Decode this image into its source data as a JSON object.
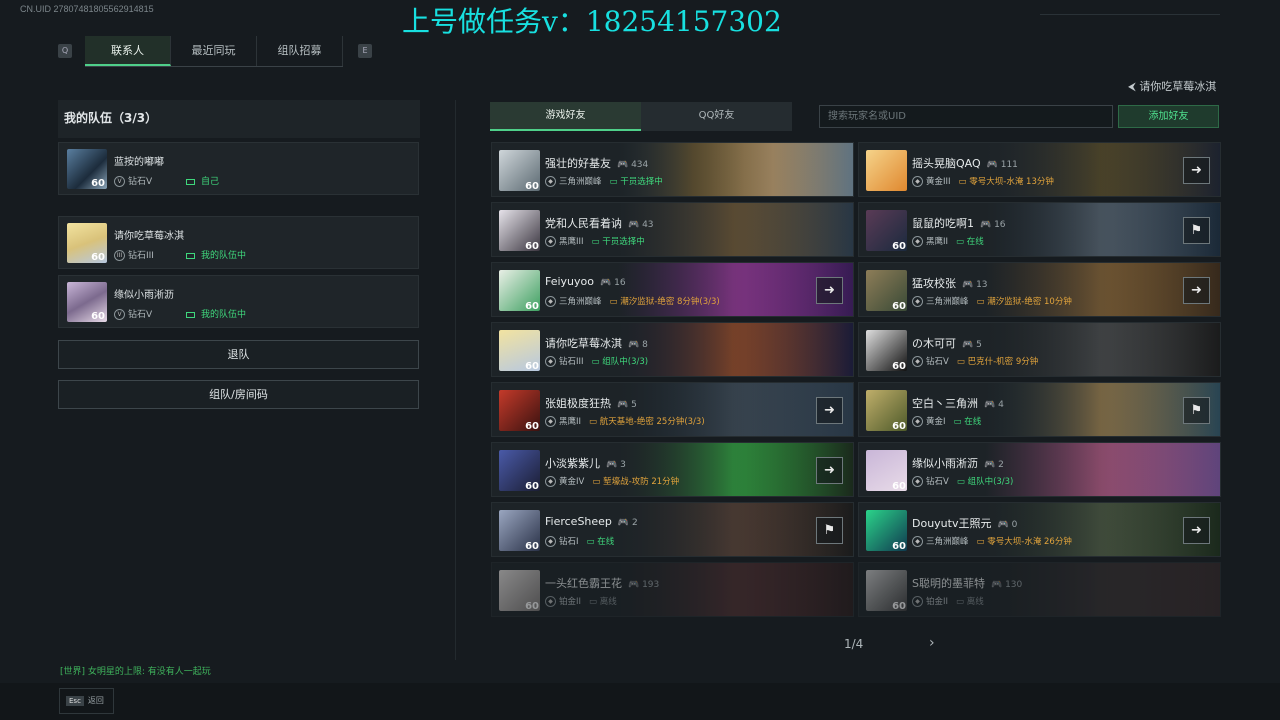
{
  "uid_text": "CN.UID 27807481805562914815",
  "watermark": "上号做任务v：18254157302",
  "tabs": {
    "q_key": "Q",
    "e_key": "E",
    "items": [
      "联系人",
      "最近同玩",
      "组队招募"
    ]
  },
  "team": {
    "title": "我的队伍（3/3）",
    "members": [
      {
        "name": "蓝按的嘟嘟",
        "rank": "钻石V",
        "status": "自己",
        "level": "60"
      },
      {
        "name": "请你吃草莓冰淇",
        "rank": "钻石III",
        "status": "我的队伍中",
        "level": "60"
      },
      {
        "name": "缘似小雨淅沥",
        "rank": "钻石V",
        "status": "我的队伍中",
        "level": "60"
      }
    ],
    "leave_label": "退队",
    "room_label": "组队/房间码"
  },
  "back_link": "请你吃草莓冰淇",
  "friend_tabs": [
    "游戏好友",
    "QQ好友"
  ],
  "search": {
    "placeholder": "搜索玩家名或UID"
  },
  "add_friend": "添加好友",
  "friends": [
    {
      "name": "强壮的好基友",
      "count": "434",
      "rank": "三角洲巅峰",
      "status": "干员选择中",
      "level": "60"
    },
    {
      "name": "摇头晃脑QAQ",
      "count": "111",
      "rank": "黄金III",
      "status": "零号大坝-水淹 13分钟",
      "level": ""
    },
    {
      "name": "党和人民看着讷",
      "count": "43",
      "rank": "黑鹰III",
      "status": "干员选择中",
      "level": "60"
    },
    {
      "name": "鼠鼠的吃啊1",
      "count": "16",
      "rank": "黑鹰II",
      "status": "在线",
      "level": "60"
    },
    {
      "name": "Feiyuyoo",
      "count": "16",
      "rank": "三角洲巅峰",
      "status": "潮汐监狱-绝密 8分钟(3/3)",
      "level": "60"
    },
    {
      "name": "猛攻校张",
      "count": "13",
      "rank": "三角洲巅峰",
      "status": "潮汐监狱-绝密 10分钟",
      "level": "60"
    },
    {
      "name": "请你吃草莓冰淇",
      "count": "8",
      "rank": "钻石III",
      "status": "组队中(3/3)",
      "level": "60"
    },
    {
      "name": "の木可可",
      "count": "5",
      "rank": "钻石V",
      "status": "巴克什-机密 9分钟",
      "level": "60"
    },
    {
      "name": "张姐极度狂热",
      "count": "5",
      "rank": "黑鹰II",
      "status": "航天基地-绝密 25分钟(3/3)",
      "level": "60"
    },
    {
      "name": "空白丶三角洲",
      "count": "4",
      "rank": "黄金I",
      "status": "在线",
      "level": "60"
    },
    {
      "name": "小淡紫紫儿",
      "count": "3",
      "rank": "黄金IV",
      "status": "堑壕战-攻防 21分钟",
      "level": "60"
    },
    {
      "name": "缘似小雨淅沥",
      "count": "2",
      "rank": "钻石V",
      "status": "组队中(3/3)",
      "level": "60"
    },
    {
      "name": "FierceSheep",
      "count": "2",
      "rank": "钻石I",
      "status": "在线",
      "level": "60"
    },
    {
      "name": "Douyutv王照元",
      "count": "0",
      "rank": "三角洲巅峰",
      "status": "零号大坝-水淹 26分钟",
      "level": "60"
    },
    {
      "name": "一头红色霸王花",
      "count": "193",
      "rank": "铂金II",
      "status": "离线",
      "level": "60"
    },
    {
      "name": "S聪明的墨菲特",
      "count": "130",
      "rank": "铂金II",
      "status": "离线",
      "level": "60"
    }
  ],
  "pager": {
    "text": "1/4",
    "next": "›"
  },
  "chat": "[世界] 女明星的上限: 有没有人一起玩",
  "esc": {
    "key": "Esc",
    "label": "返回"
  }
}
